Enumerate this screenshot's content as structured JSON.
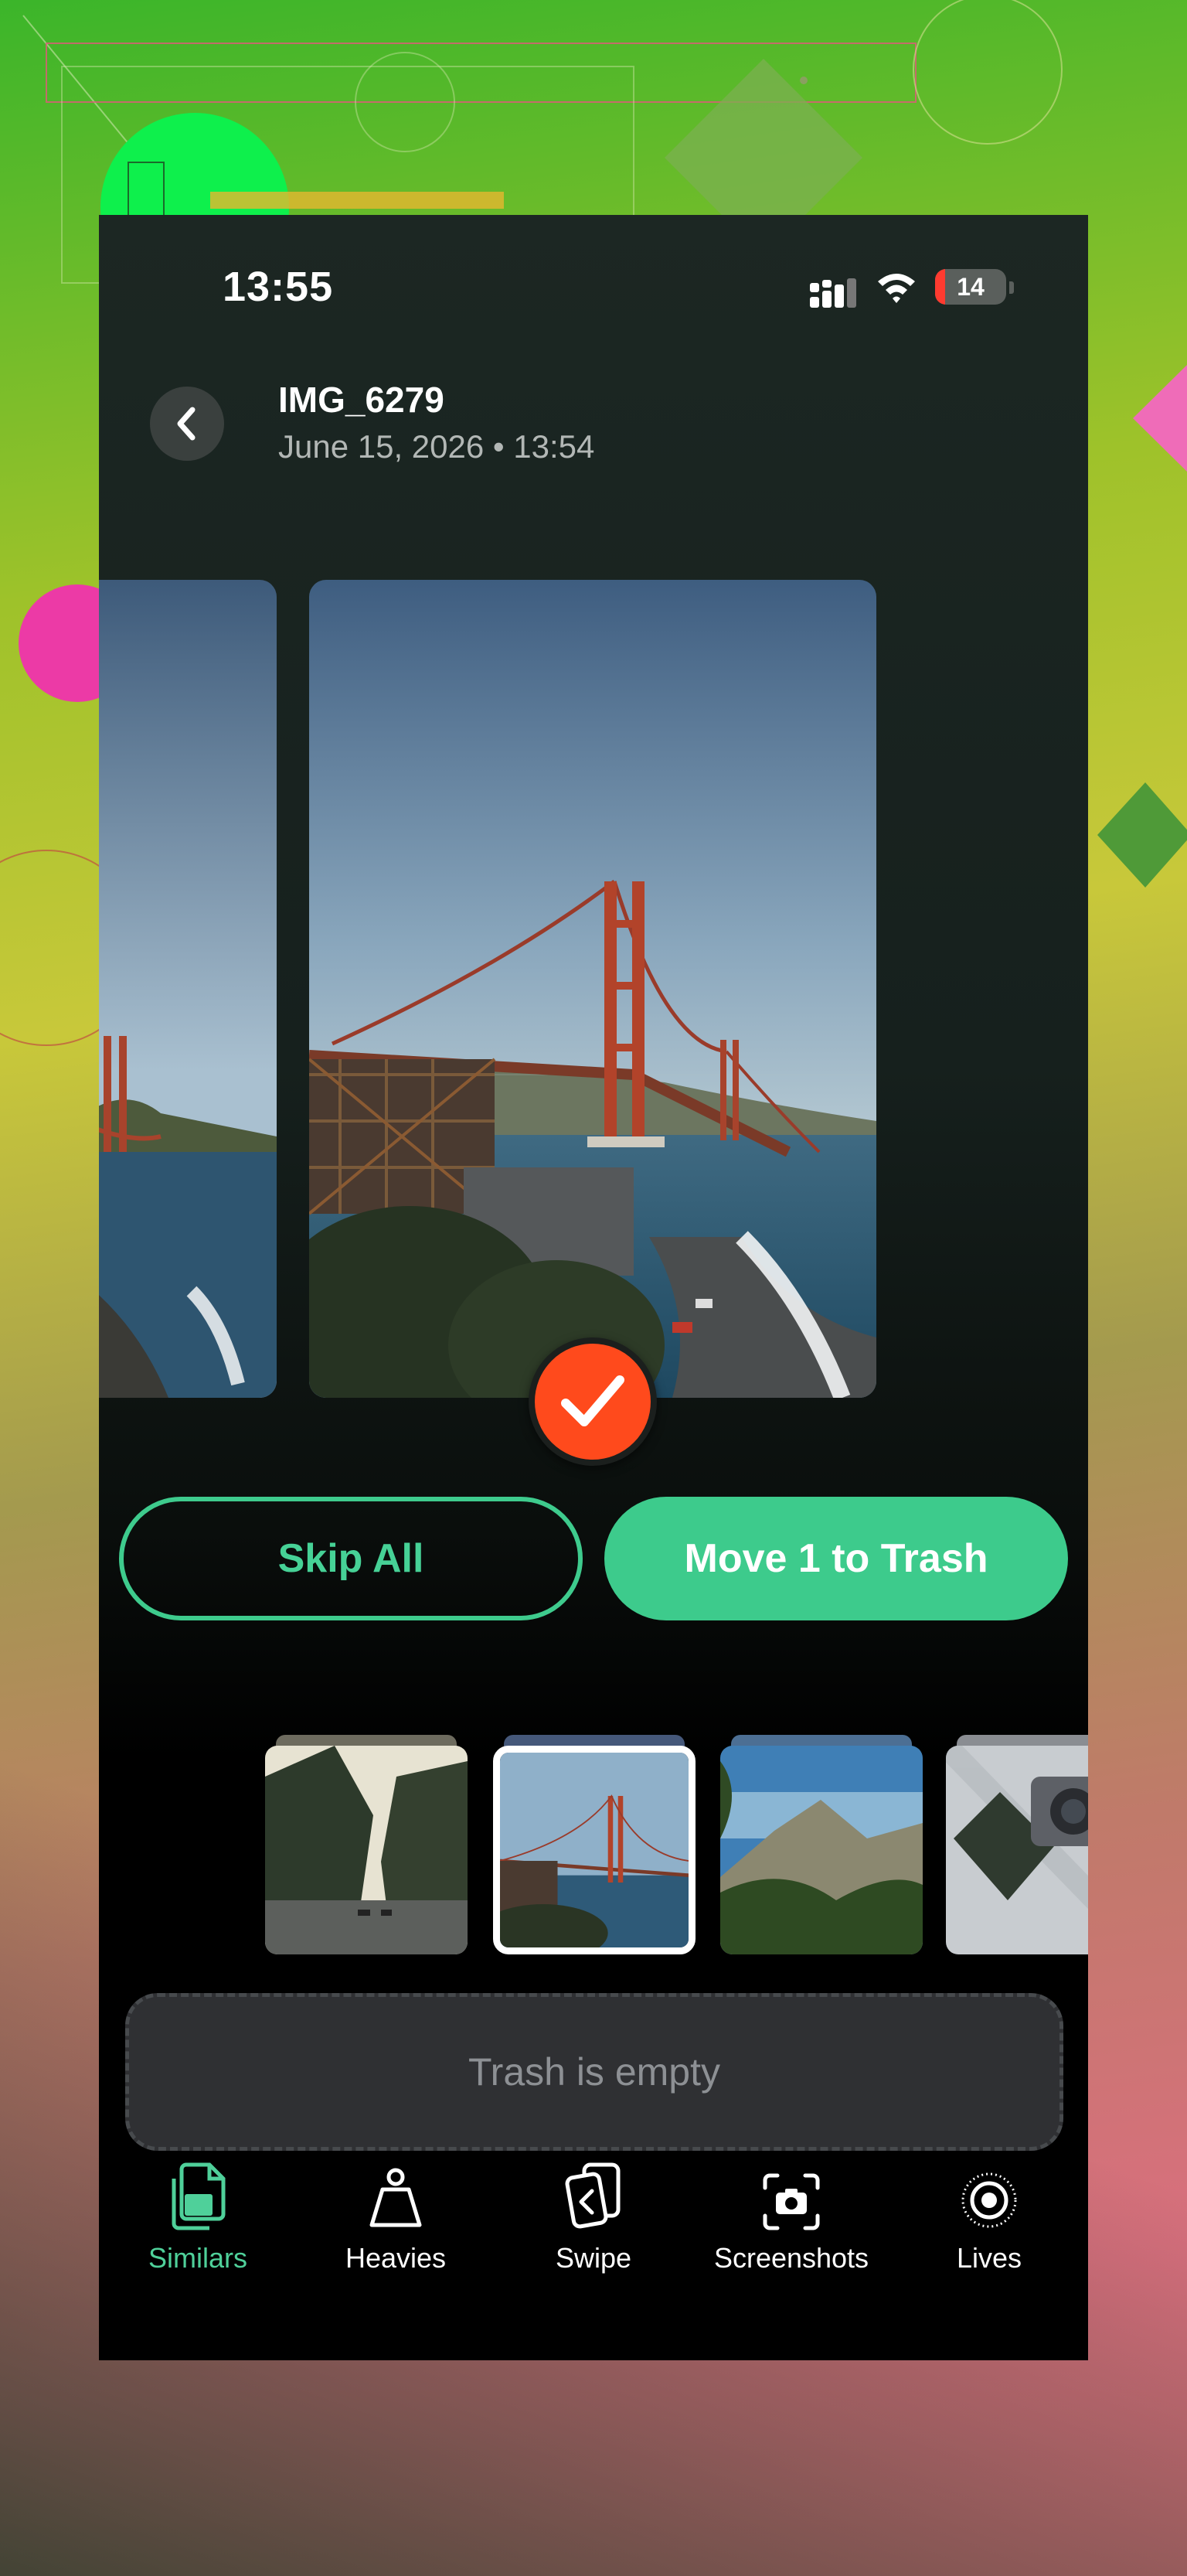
{
  "status_bar": {
    "time": "13:55",
    "battery_level": 14,
    "battery_text": "14",
    "icons": [
      "cellular-signal-icon",
      "wifi-icon",
      "battery-icon"
    ]
  },
  "header": {
    "back_icon": "chevron-left-icon",
    "title": "IMG_6279",
    "subtitle": "June 15, 2026 • 13:54"
  },
  "carousel": {
    "selected_badge_icon": "checkmark-icon"
  },
  "actions": {
    "skip_label": "Skip All",
    "trash_label": "Move 1 to Trash"
  },
  "thumbnails": [
    {
      "subject": "forest-road",
      "selected": false
    },
    {
      "subject": "golden-gate-bridge",
      "selected": true
    },
    {
      "subject": "mountain-landscape",
      "selected": false
    },
    {
      "subject": "camera-on-bed",
      "selected": false
    }
  ],
  "trash_zone": {
    "label": "Trash is empty"
  },
  "tabbar": {
    "active_color": "#4fd09a",
    "items": [
      {
        "label": "Similars",
        "icon": "copy-documents-icon",
        "active": true
      },
      {
        "label": "Heavies",
        "icon": "weight-icon",
        "active": false
      },
      {
        "label": "Swipe",
        "icon": "swipe-cards-icon",
        "active": false
      },
      {
        "label": "Screenshots",
        "icon": "screenshot-camera-icon",
        "active": false
      },
      {
        "label": "Lives",
        "icon": "live-photo-icon",
        "active": false
      }
    ]
  },
  "colors": {
    "accent_green": "#3dcb8c",
    "badge_red": "#ff4a1c",
    "battery_red": "#ff3b30"
  }
}
